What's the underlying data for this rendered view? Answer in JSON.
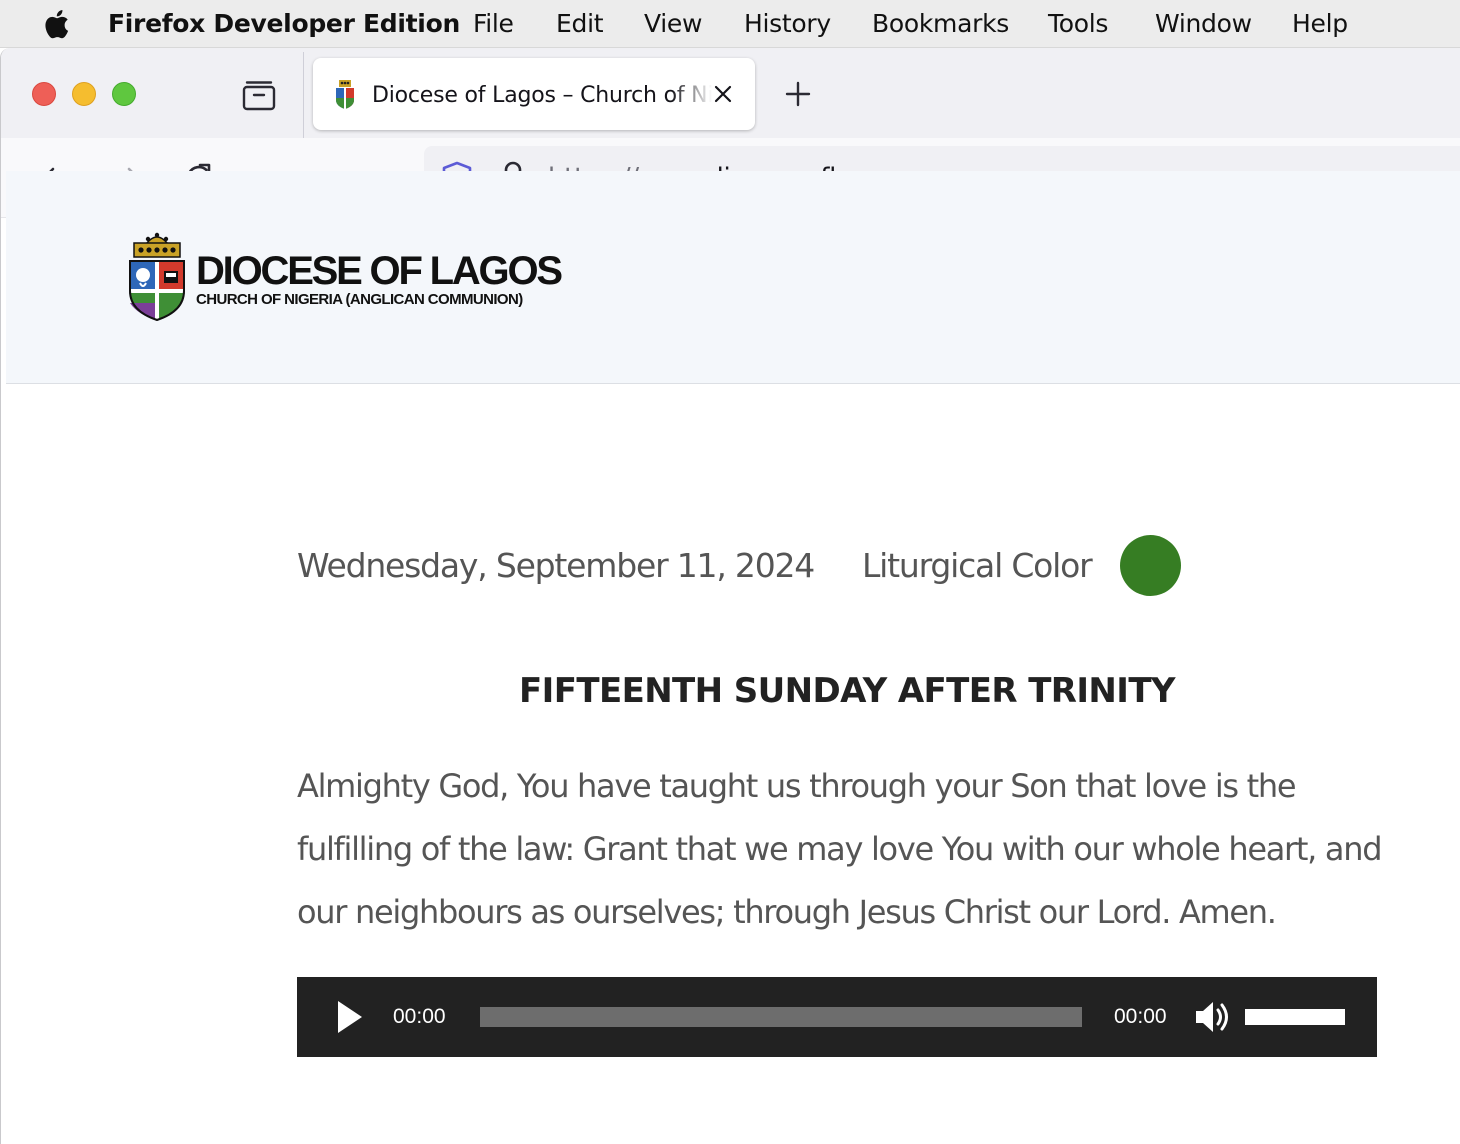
{
  "menubar": {
    "app_name": "Firefox Developer Edition",
    "items": [
      "File",
      "Edit",
      "View",
      "History",
      "Bookmarks",
      "Tools",
      "Window",
      "Help"
    ]
  },
  "browser": {
    "tab": {
      "title": "Diocese of Lagos – Church of Nigeria (Anglican Communion)"
    },
    "url": {
      "scheme": "https://www.",
      "host": "dioceseoflagos.org"
    }
  },
  "site": {
    "logo_name": "DIOCESE OF LAGOS",
    "logo_subtitle": "CHURCH OF NIGERIA (ANGLICAN COMMUNION)"
  },
  "day": {
    "date": "Wednesday, September 11, 2024",
    "liturgical_color_label": "Liturgical Color",
    "liturgical_color": "#367d23",
    "title": "FIFTEENTH SUNDAY AFTER TRINITY",
    "collect": "Almighty God, You have taught us through your Son that love is the fulfilling of the law: Grant that we may love You with our whole heart, and our neighbours as ourselves; through Jesus Christ our Lord. Amen."
  },
  "audio_player": {
    "current_time": "00:00",
    "duration": "00:00",
    "progress": 0,
    "volume": 1.0
  },
  "colors": {
    "player_bg": "#222222",
    "menubar_bg": "#ececec",
    "header_bg": "#f4f7fb"
  }
}
